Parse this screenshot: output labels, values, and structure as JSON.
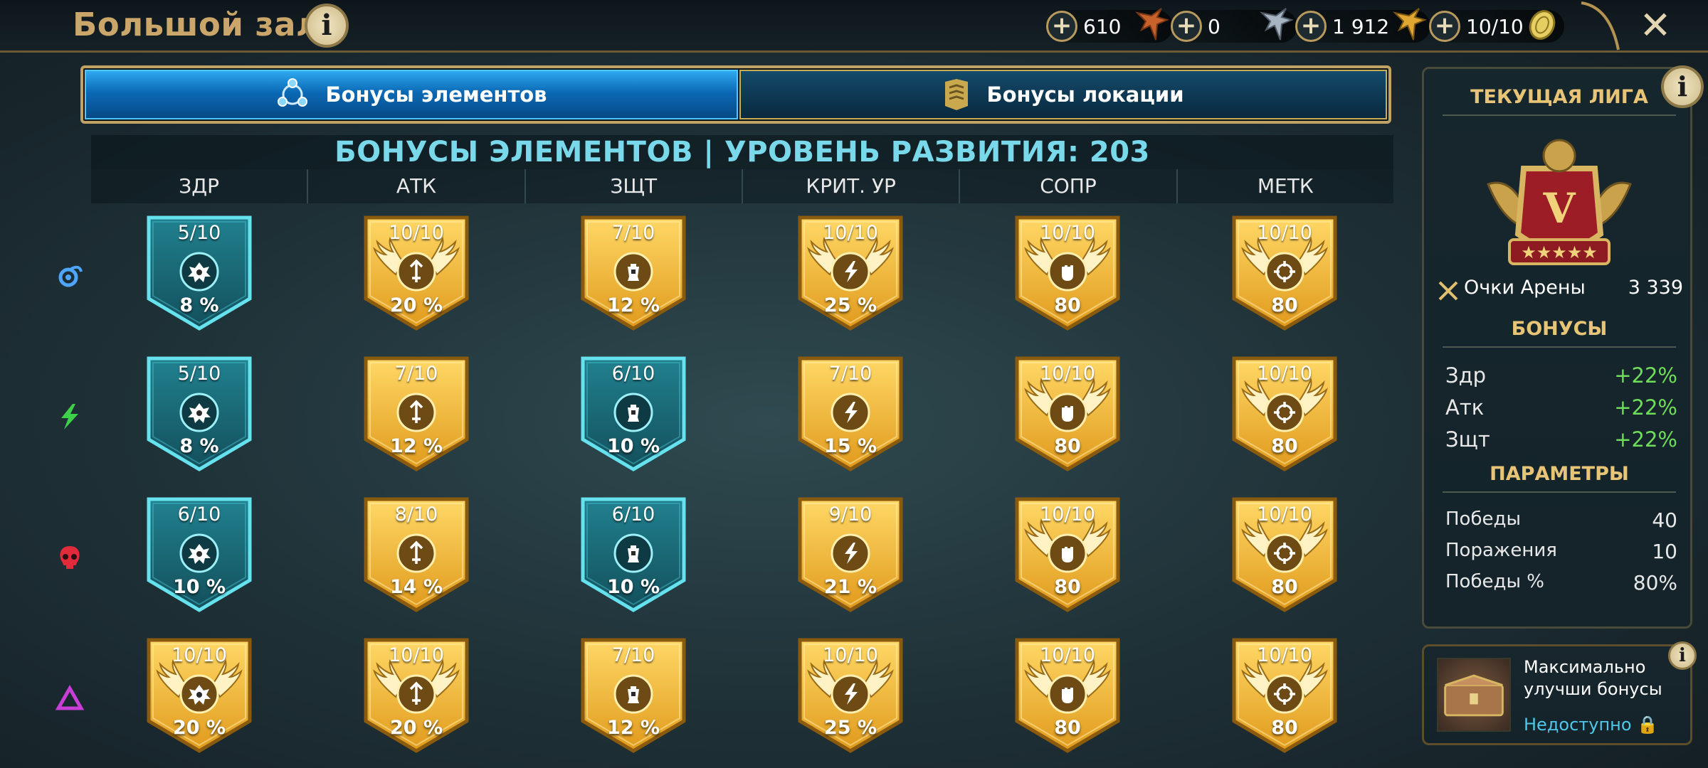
{
  "header": {
    "title": "Большой зал",
    "resources": [
      {
        "value": "610",
        "icon": "bronze-medal-icon",
        "color": "#c8622d"
      },
      {
        "value": "0",
        "icon": "silver-medal-icon",
        "color": "#9aa7b5"
      },
      {
        "value": "1 912",
        "icon": "gold-medal-icon",
        "color": "#e0a833"
      },
      {
        "value": "10/10",
        "icon": "arena-token-icon",
        "color": "#d8c35a"
      }
    ]
  },
  "tabs": [
    {
      "label": "Бонусы элементов",
      "active": true
    },
    {
      "label": "Бонусы локации",
      "active": false
    }
  ],
  "table": {
    "heading": "БОНУСЫ ЭЛЕМЕНТОВ | УРОВЕНЬ РАЗВИТИЯ: 203",
    "columns": [
      "ЗДР",
      "АТК",
      "ЗЩТ",
      "КРИТ. УР",
      "СОПР",
      "МЕТК"
    ],
    "column_icons": [
      "health-icon",
      "attack-icon",
      "defense-icon",
      "crit-damage-icon",
      "resistance-icon",
      "accuracy-icon"
    ],
    "rows": [
      {
        "affinity": "magic",
        "cells": [
          {
            "level": "5/10",
            "value": "8 %",
            "style": "blue",
            "winged": false
          },
          {
            "level": "10/10",
            "value": "20 %",
            "style": "gold",
            "winged": true
          },
          {
            "level": "7/10",
            "value": "12 %",
            "style": "gold",
            "winged": false
          },
          {
            "level": "10/10",
            "value": "25 %",
            "style": "gold",
            "winged": true
          },
          {
            "level": "10/10",
            "value": "80",
            "style": "gold",
            "winged": true
          },
          {
            "level": "10/10",
            "value": "80",
            "style": "gold",
            "winged": true
          }
        ]
      },
      {
        "affinity": "force",
        "cells": [
          {
            "level": "5/10",
            "value": "8 %",
            "style": "blue",
            "winged": false
          },
          {
            "level": "7/10",
            "value": "12 %",
            "style": "gold",
            "winged": false
          },
          {
            "level": "6/10",
            "value": "10 %",
            "style": "blue",
            "winged": false
          },
          {
            "level": "7/10",
            "value": "15 %",
            "style": "gold",
            "winged": false
          },
          {
            "level": "10/10",
            "value": "80",
            "style": "gold",
            "winged": true
          },
          {
            "level": "10/10",
            "value": "80",
            "style": "gold",
            "winged": true
          }
        ]
      },
      {
        "affinity": "spirit",
        "cells": [
          {
            "level": "6/10",
            "value": "10 %",
            "style": "blue",
            "winged": false
          },
          {
            "level": "8/10",
            "value": "14 %",
            "style": "gold",
            "winged": false
          },
          {
            "level": "6/10",
            "value": "10 %",
            "style": "blue",
            "winged": false
          },
          {
            "level": "9/10",
            "value": "21 %",
            "style": "gold",
            "winged": false
          },
          {
            "level": "10/10",
            "value": "80",
            "style": "gold",
            "winged": true
          },
          {
            "level": "10/10",
            "value": "80",
            "style": "gold",
            "winged": true
          }
        ]
      },
      {
        "affinity": "void",
        "cells": [
          {
            "level": "10/10",
            "value": "20 %",
            "style": "gold",
            "winged": true
          },
          {
            "level": "10/10",
            "value": "20 %",
            "style": "gold",
            "winged": true
          },
          {
            "level": "7/10",
            "value": "12 %",
            "style": "gold",
            "winged": false
          },
          {
            "level": "10/10",
            "value": "25 %",
            "style": "gold",
            "winged": true
          },
          {
            "level": "10/10",
            "value": "80",
            "style": "gold",
            "winged": true
          },
          {
            "level": "10/10",
            "value": "80",
            "style": "gold",
            "winged": true
          }
        ]
      }
    ]
  },
  "league": {
    "title": "ТЕКУЩАЯ ЛИГА",
    "rank": "V",
    "arena_points_label": "Очки Арены",
    "arena_points_value": "3 339",
    "bonuses_title": "БОНУСЫ",
    "bonuses": [
      {
        "label": "Здр",
        "value": "+22%"
      },
      {
        "label": "Атк",
        "value": "+22%"
      },
      {
        "label": "Зщт",
        "value": "+22%"
      }
    ],
    "params_title": "ПАРАМЕТРЫ",
    "params": [
      {
        "label": "Победы",
        "value": "40"
      },
      {
        "label": "Поражения",
        "value": "10"
      },
      {
        "label": "Победы %",
        "value": "80%"
      }
    ]
  },
  "upgrade": {
    "text": "Максимально улучши бонусы",
    "status": "Недоступно"
  },
  "colors": {
    "gold": "#f2bd35",
    "blue": "#1c6f7c",
    "accent_text": "#79d9ea",
    "bonus_green": "#6fdc5a"
  }
}
